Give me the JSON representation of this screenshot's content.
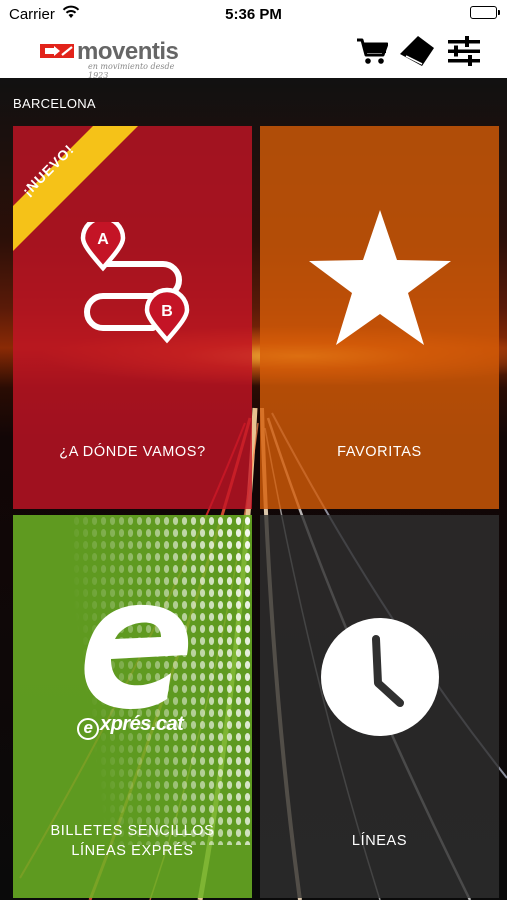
{
  "status_bar": {
    "carrier": "Carrier",
    "time": "5:36 PM"
  },
  "header": {
    "brand": "moventis",
    "tagline": "en movimiento desde 1923",
    "icons": [
      "cart-icon",
      "ticket-icon",
      "settings-sliders-icon"
    ]
  },
  "region": "BARCELONA",
  "tiles": {
    "route": {
      "label": "¿A DÓNDE VAMOS?",
      "badge": "¡NUEVO!",
      "pin_a": "A",
      "pin_b": "B"
    },
    "favorites": {
      "label": "FAVORITAS"
    },
    "express": {
      "label_line1": "BILLETES SENCILLOS",
      "label_line2": "LÍNEAS EXPRÉS",
      "brand": "exprés.cat",
      "brand_initial": "e",
      "brand_rest": "xprés.cat"
    },
    "lines": {
      "label": "LÍNEAS"
    }
  },
  "colors": {
    "route_tile": "#c41426",
    "favorites_tile": "#d65c08",
    "express_tile": "#6cb224",
    "lines_tile": "#303030",
    "new_badge": "#f5c218",
    "brand_red": "#e2231a",
    "brand_gray": "#666666"
  }
}
